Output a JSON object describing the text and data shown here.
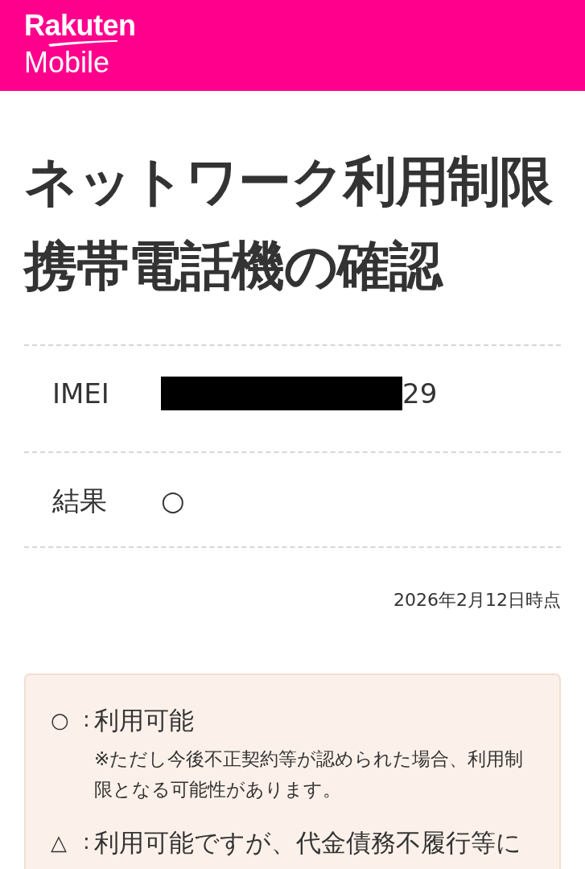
{
  "header": {
    "logo": {
      "brand": "Rakuten",
      "product": "Mobile"
    }
  },
  "title": "ネットワーク利用制限携帯電話機の確認",
  "details": [
    {
      "label": "IMEI",
      "value": "29",
      "redacted": true
    },
    {
      "label": "結果",
      "value": "○"
    }
  ],
  "as_of": "2026年2月12日時点",
  "legend": [
    {
      "symbol": "○",
      "separator": ":",
      "label": "利用可能",
      "note": "※ただし今後不正契約等が認められた場合、利用制限となる可能性があります。"
    },
    {
      "symbol": "△",
      "separator": ":",
      "label": "利用可能ですが、代金債務不履行等に"
    }
  ]
}
